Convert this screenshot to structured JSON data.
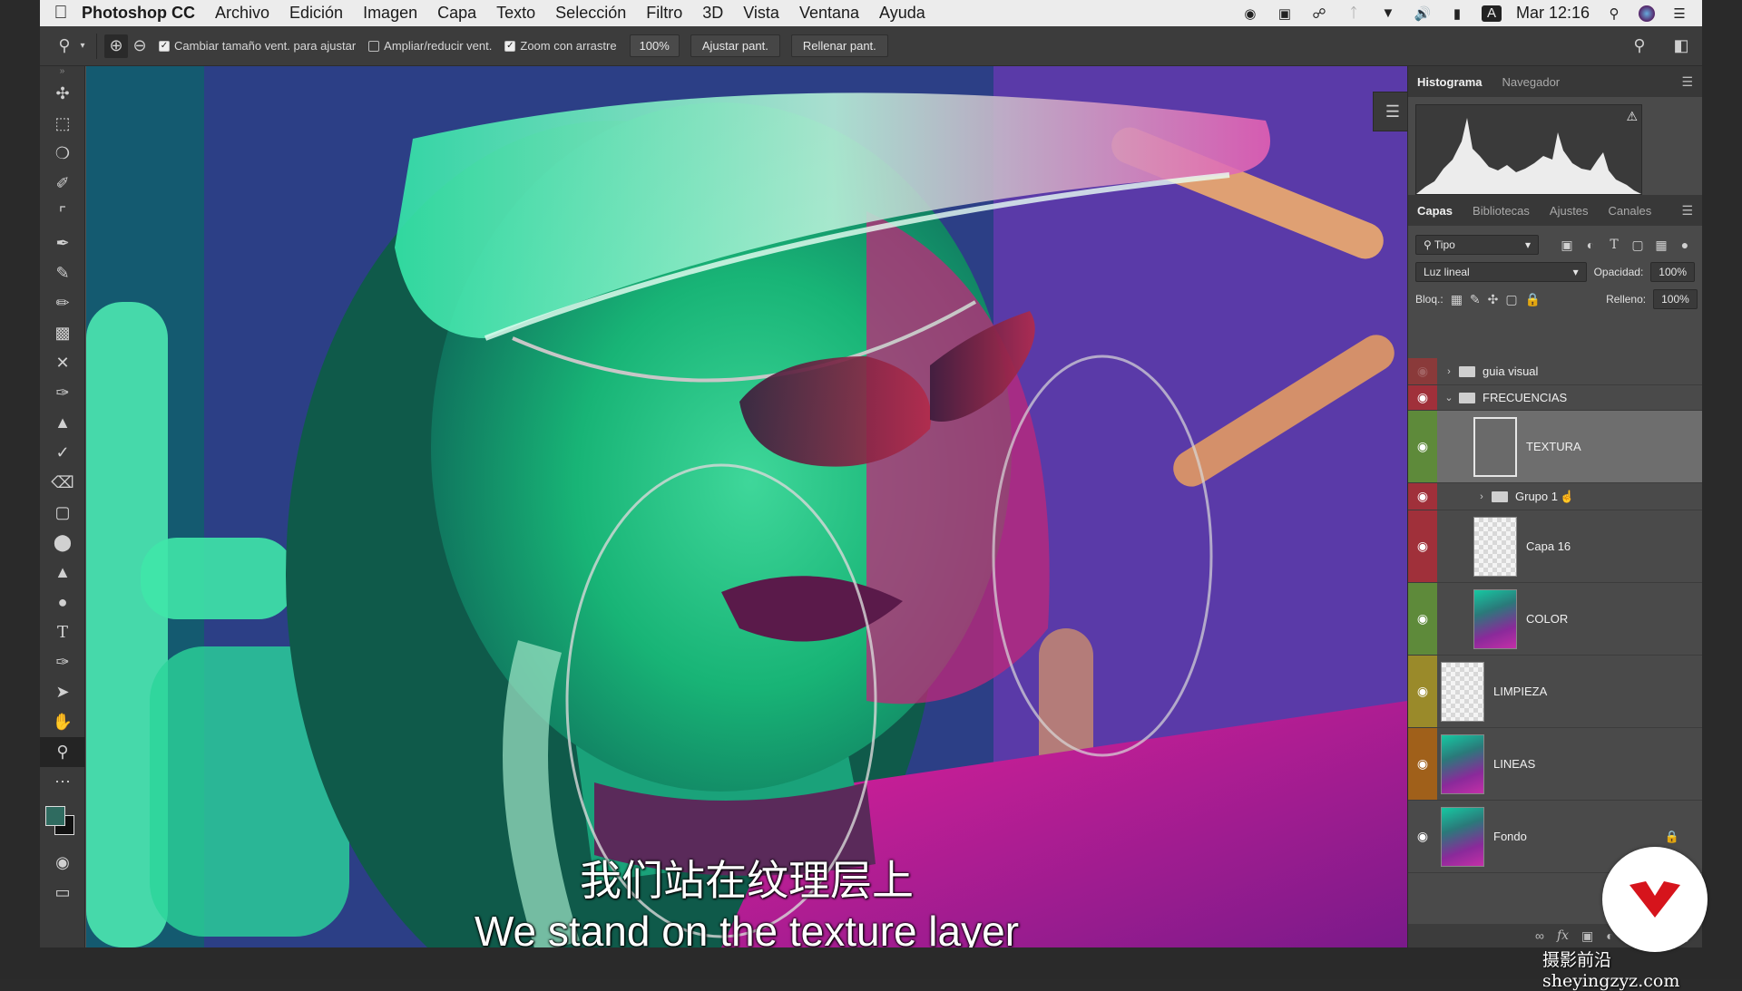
{
  "menubar": {
    "app_name": "Photoshop CC",
    "menus": [
      "Archivo",
      "Edición",
      "Imagen",
      "Capa",
      "Texto",
      "Selección",
      "Filtro",
      "3D",
      "Vista",
      "Ventana",
      "Ayuda"
    ],
    "clock": "Mar 12:16"
  },
  "options_bar": {
    "resize_windows_label": "Cambiar tamaño vent. para ajustar",
    "zoom_all_label": "Ampliar/reducir vent.",
    "scrubby_zoom_label": "Zoom con arrastre",
    "zoom_value": "100%",
    "fit_screen_label": "Ajustar pant.",
    "fill_screen_label": "Rellenar pant."
  },
  "histogram_panel": {
    "tabs": [
      "Histograma",
      "Navegador"
    ],
    "active_tab": "Histograma"
  },
  "layers_panel": {
    "tabs": [
      "Capas",
      "Bibliotecas",
      "Ajustes",
      "Canales"
    ],
    "active_tab": "Capas",
    "filter_label": "Tipo",
    "blend_mode": "Luz lineal",
    "opacity_label": "Opacidad:",
    "opacity_value": "100%",
    "lock_label": "Bloq.:",
    "fill_label": "Relleno:",
    "fill_value": "100%",
    "layers": [
      {
        "name": "guia visual",
        "kind": "group",
        "visible": false,
        "color": "#8a3a3a",
        "expanded": false
      },
      {
        "name": "FRECUENCIAS",
        "kind": "group",
        "visible": true,
        "color": "#a0303a",
        "expanded": true
      },
      {
        "name": "TEXTURA",
        "kind": "layer",
        "visible": true,
        "color": "#5e8a3a",
        "selected": true
      },
      {
        "name": "Grupo 1",
        "kind": "group",
        "visible": true,
        "color": "#a0303a",
        "expanded": false
      },
      {
        "name": "Capa 16",
        "kind": "layer",
        "visible": true,
        "color": "#a0303a"
      },
      {
        "name": "COLOR",
        "kind": "layer",
        "visible": true,
        "color": "#5e8a3a"
      },
      {
        "name": "LIMPIEZA",
        "kind": "layer",
        "visible": true,
        "color": "#9a8a2a"
      },
      {
        "name": "LINEAS",
        "kind": "layer",
        "visible": true,
        "color": "#a0601a"
      },
      {
        "name": "Fondo",
        "kind": "layer",
        "visible": true,
        "color": "#4a4a4a",
        "locked": true
      }
    ]
  },
  "subtitles": {
    "zh": "我们站在纹理层上",
    "en": "We stand on the texture layer"
  },
  "watermark": "摄影前沿sheyingzyz.com",
  "colors": {
    "foreground": "#2f6b60",
    "background": "#111111",
    "brand_red": "#d6141c"
  }
}
